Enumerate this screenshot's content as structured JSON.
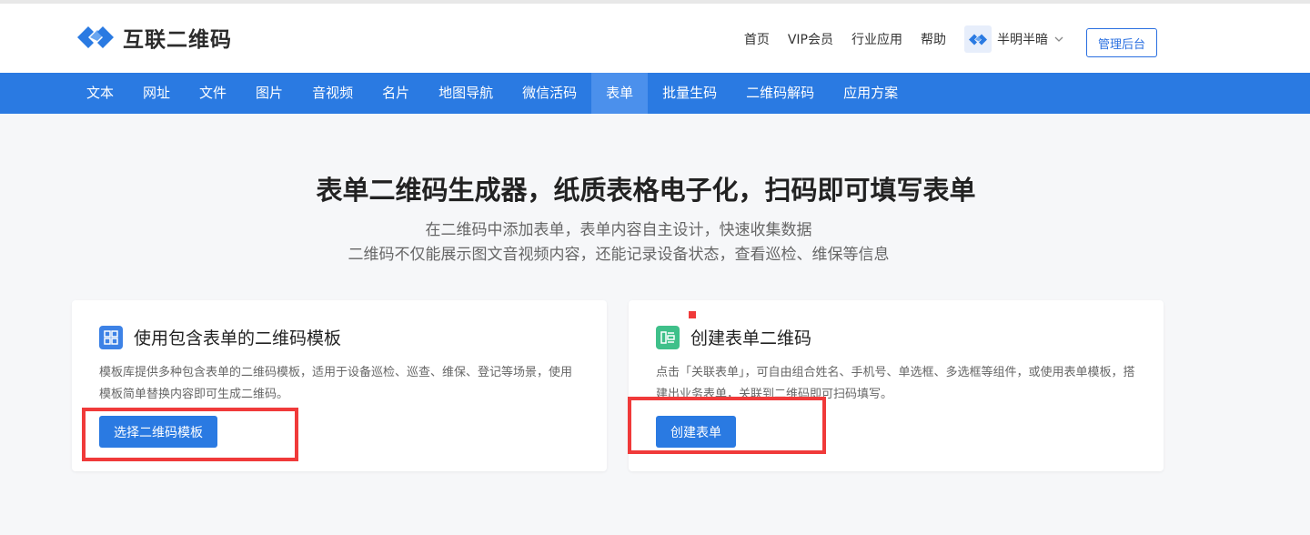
{
  "brand": {
    "name": "互联二维码",
    "accent": "#2a7ae2"
  },
  "top_nav": {
    "items": [
      "首页",
      "VIP会员",
      "行业应用",
      "帮助"
    ],
    "user": {
      "name": "半明半暗",
      "avatar_icon": "brand-logo-icon",
      "dropdown_icon": "chevron-down-icon"
    },
    "admin_label": "管理后台"
  },
  "main_nav": {
    "items": [
      "文本",
      "网址",
      "文件",
      "图片",
      "音视频",
      "名片",
      "地图导航",
      "微信活码",
      "表单",
      "批量生码",
      "二维码解码",
      "应用方案"
    ],
    "active": "表单"
  },
  "hero": {
    "title": "表单二维码生成器，纸质表格电子化，扫码即可填写表单",
    "subtitle_1": "在二维码中添加表单，表单内容自主设计，快速收集数据",
    "subtitle_2": "二维码不仅能展示图文音视频内容，还能记录设备状态，查看巡检、维保等信息"
  },
  "cards": [
    {
      "icon": "qr-grid-icon",
      "title": "使用包含表单的二维码模板",
      "desc": "模板库提供多种包含表单的二维码模板，适用于设备巡检、巡查、维保、登记等场景，使用模板简单替换内容即可生成二维码。",
      "button": "选择二维码模板"
    },
    {
      "icon": "form-layout-icon",
      "title": "创建表单二维码",
      "desc": "点击「关联表单」，可自由组合姓名、手机号、单选框、多选框等组件，或使用表单模板，搭建出业务表单，关联到二维码即可扫码填写。",
      "button": "创建表单"
    }
  ]
}
